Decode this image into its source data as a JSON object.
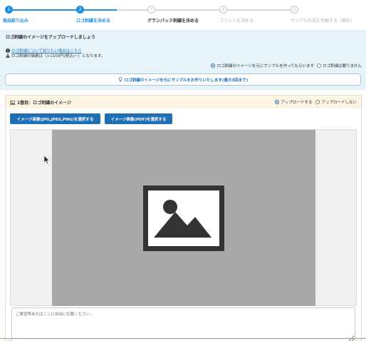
{
  "stepper": {
    "steps": [
      {
        "num": "1",
        "label": "商品絞り込み",
        "state": "done"
      },
      {
        "num": "2",
        "label": "ロゴ刺繍を決める",
        "state": "done"
      },
      {
        "num": "3",
        "label": "グランパック刺繍を決める",
        "state": "current"
      },
      {
        "num": "4",
        "label": "プリントを決める",
        "state": "todo"
      },
      {
        "num": "5",
        "label": "サンプル作成を依頼する（無料）",
        "state": "todo"
      }
    ],
    "active_color": "#1d8fe0"
  },
  "info": {
    "title": "ロゴ刺繍のイメージをアップロードしましょう",
    "help_link": "ロゴ刺繍について知りたい場合はこちら",
    "price_note": "ロゴ刺繍の価格は（+1100円(税込)~）となります。",
    "radio_options": [
      "ロゴ刺繍のイメージを元にサンプルを作ってもらいます",
      "ロゴ刺繍は要りません"
    ],
    "radio_selected": 0,
    "sample_button": "ロゴ刺繍のイメージを元にサンプルをお作りいたします(最大3回まで)"
  },
  "card": {
    "title": "1箇目：ロゴ刺繍のイメージ",
    "radio_options": [
      "アップロードする",
      "アップロードしない"
    ],
    "radio_selected": 0,
    "btn_image": "イメージ画像(JPG,JPEG,PNG)を選択する",
    "btn_pdf": "イメージ画像(PDF)を選択する",
    "comment_placeholder": "ご要望等あればここに自由に記載ください。"
  },
  "icons": {
    "info": "info-circle-icon",
    "warning": "warning-triangle-icon",
    "bulb": "lightbulb-icon",
    "image_placeholder": "image-placeholder-icon",
    "card": "image-card-icon",
    "cursor": "mouse-cursor-icon"
  },
  "colors": {
    "primary_button": "#1f6fb5",
    "info_panel_bg": "#e6f3f9",
    "card_header_bg": "#fbf5e2",
    "preview_bg": "#a9a9a9"
  }
}
